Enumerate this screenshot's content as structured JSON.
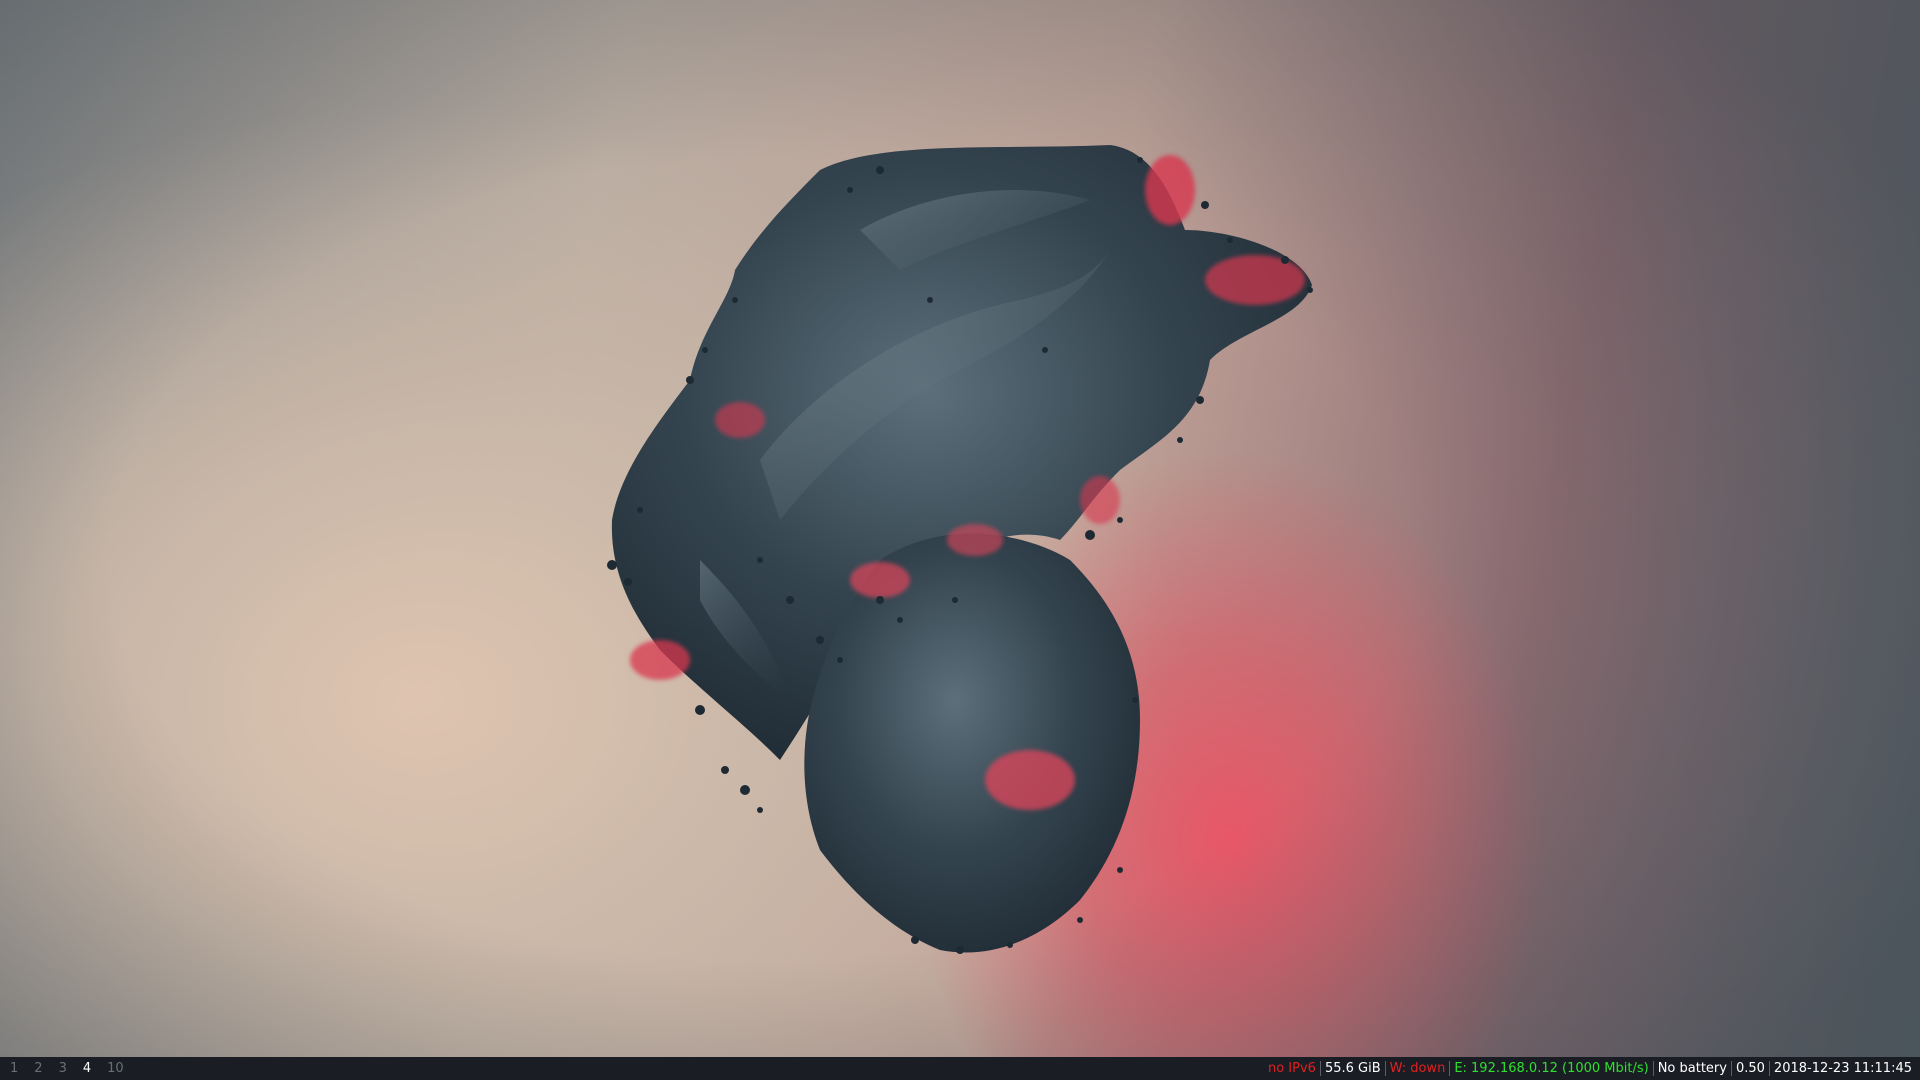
{
  "workspaces": [
    {
      "label": "1",
      "focused": false
    },
    {
      "label": "2",
      "focused": false
    },
    {
      "label": "3",
      "focused": false
    },
    {
      "label": "4",
      "focused": true
    },
    {
      "label": "10",
      "focused": false
    }
  ],
  "status": {
    "ipv6": {
      "text": "no IPv6",
      "color": "#e02020"
    },
    "disk": {
      "text": "55.6 GiB",
      "color": "#ffffff"
    },
    "wireless": {
      "text": "W: down",
      "color": "#e02020"
    },
    "ethernet": {
      "text": "E: 192.168.0.12 (1000 Mbit/s)",
      "color": "#2ee02e"
    },
    "battery": {
      "text": "No battery",
      "color": "#ffffff"
    },
    "load": {
      "text": "0.50",
      "color": "#ffffff"
    },
    "datetime": {
      "text": "2018-12-23 11:11:45",
      "color": "#ffffff"
    }
  },
  "colors": {
    "bar_background": "#1a1d24",
    "inactive_workspace": "#6a6e78",
    "focused_workspace": "#ffffff"
  }
}
